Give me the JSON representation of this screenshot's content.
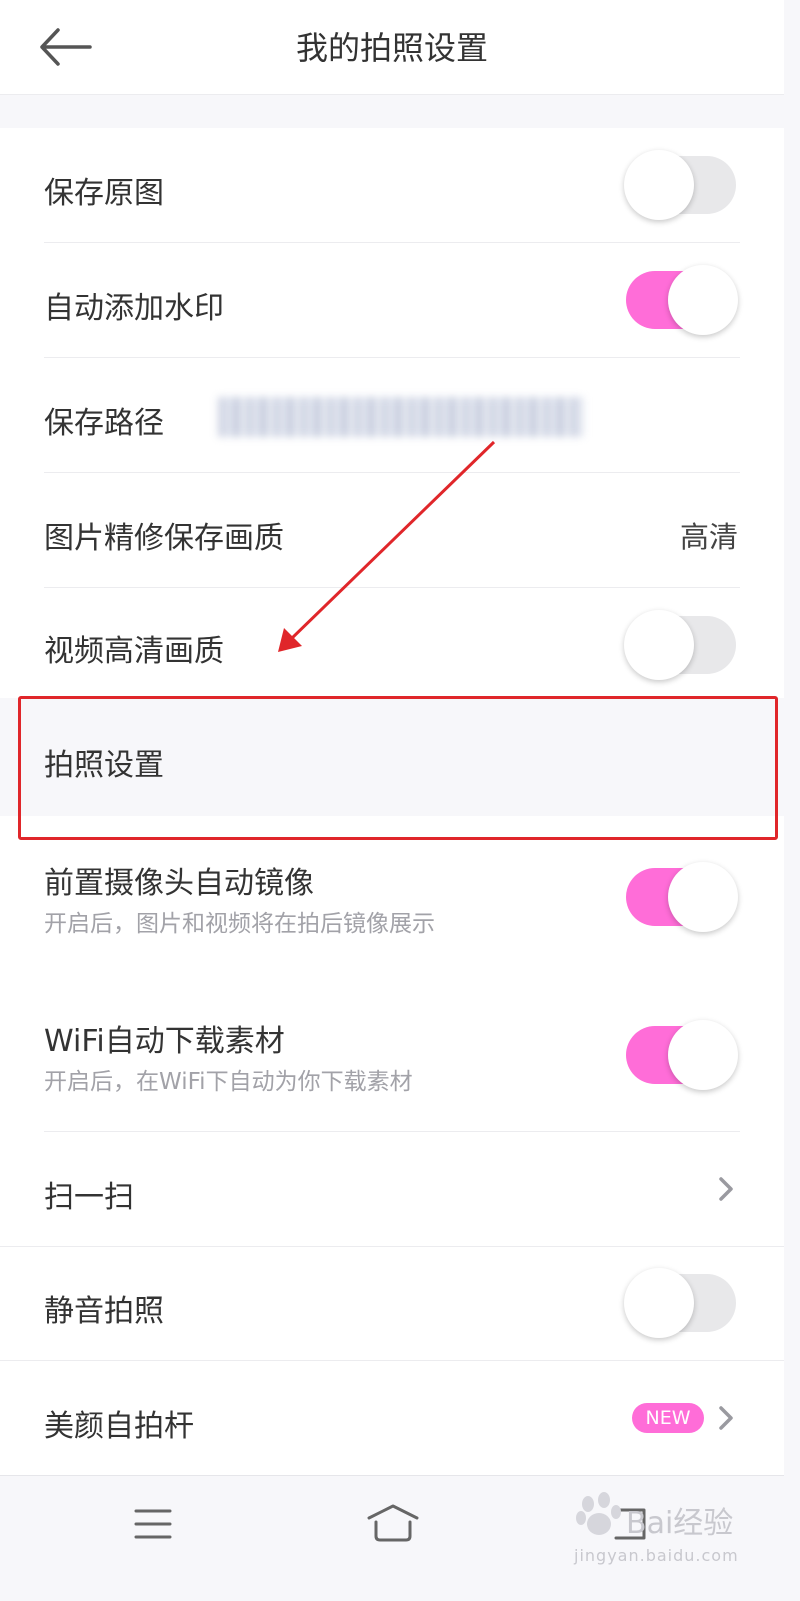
{
  "header": {
    "title": "我的拍照设置",
    "back_icon": "arrow-left-icon"
  },
  "settings": {
    "save_original": {
      "label": "保存原图",
      "enabled": false
    },
    "auto_watermark": {
      "label": "自动添加水印",
      "enabled": true
    },
    "save_path": {
      "label": "保存路径"
    },
    "retouch_quality": {
      "label": "图片精修保存画质",
      "value": "高清"
    },
    "video_hd": {
      "label": "视频高清画质",
      "enabled": false
    }
  },
  "photo_section": {
    "heading": "拍照设置",
    "front_mirror": {
      "label": "前置摄像头自动镜像",
      "desc": "开启后，图片和视频将在拍后镜像展示",
      "enabled": true
    },
    "wifi_download": {
      "label": "WiFi自动下载素材",
      "desc": "开启后，在WiFi下自动为你下载素材",
      "enabled": true
    },
    "scan": {
      "label": "扫一扫"
    },
    "silent_shot": {
      "label": "静音拍照",
      "enabled": false
    },
    "selfie_stick": {
      "label": "美颜自拍杆",
      "badge": "NEW"
    }
  },
  "colors": {
    "accent": "#ff6dd8",
    "annotation": "#e0262a"
  },
  "bottom_nav": {
    "menu_icon": "menu-icon",
    "home_icon": "home-icon",
    "back_icon": "back-icon"
  },
  "watermark": {
    "text": "Bai经验",
    "sub": "jingyan.baidu.com"
  }
}
